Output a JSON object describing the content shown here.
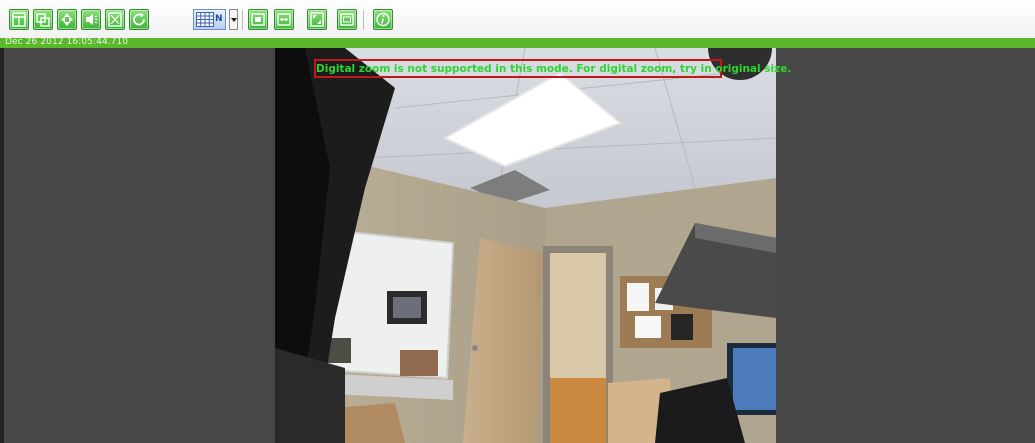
{
  "toolbar": {
    "buttons": [
      {
        "name": "window-layout-icon"
      },
      {
        "name": "snapshot-icon"
      },
      {
        "name": "ptz-icon"
      },
      {
        "name": "speaker-icon"
      },
      {
        "name": "fit-window-icon"
      },
      {
        "name": "refresh-icon"
      },
      {
        "name": "grid-layout-icon"
      },
      {
        "name": "fit-icon"
      },
      {
        "name": "stretch-icon"
      },
      {
        "name": "fullscreen-icon"
      },
      {
        "name": "original-size-icon"
      },
      {
        "name": "info-icon"
      }
    ],
    "grid_mode_label": "N",
    "accent_color": "#3db43a"
  },
  "status": {
    "timestamp": "Dec 26 2012 16:05:44.710",
    "bar_color": "#5cb82b"
  },
  "video": {
    "notice": "Digital zoom is not supported in this mode. For digital zoom, try in original size.",
    "notice_border_color": "#c01818",
    "notice_text_color": "#2fd52f"
  }
}
